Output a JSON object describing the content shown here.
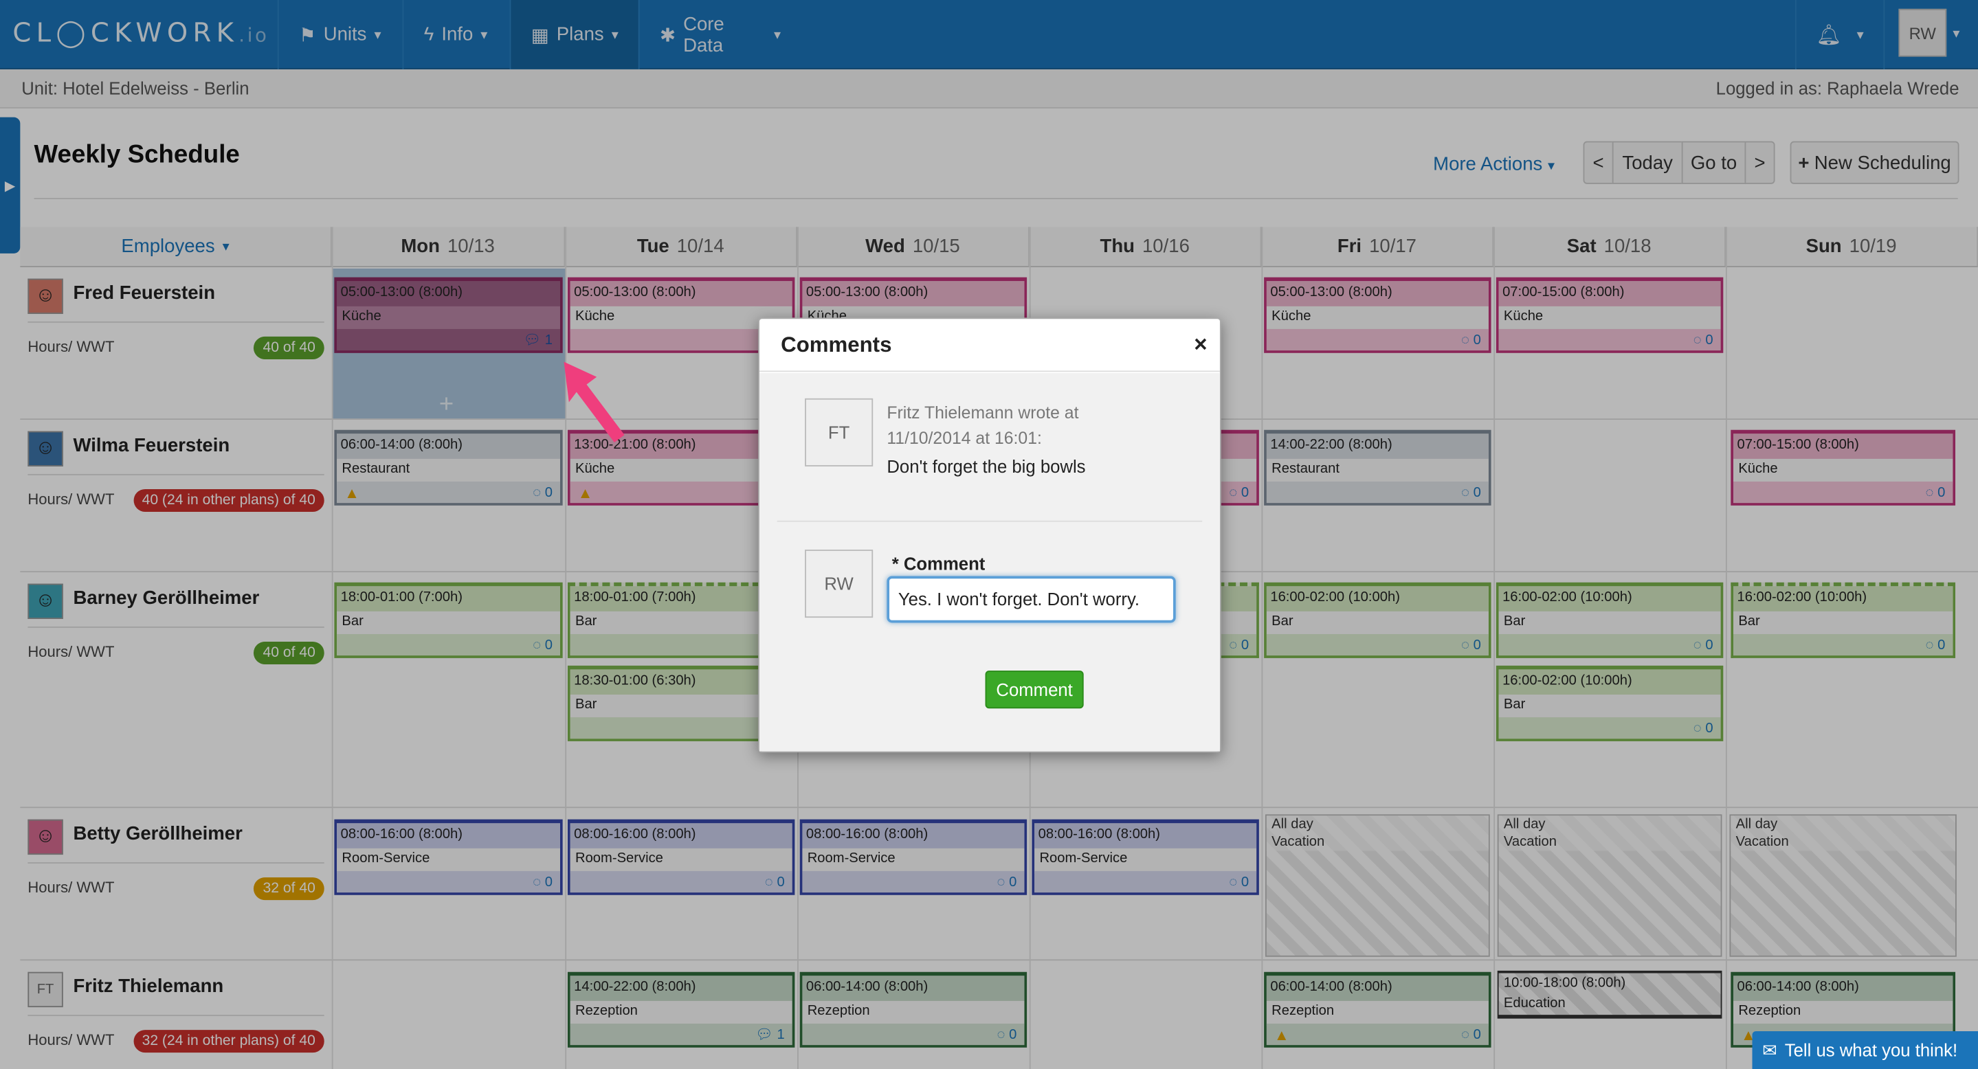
{
  "app": {
    "logo_main": "CL◯CKWORK",
    "logo_suffix": ".io"
  },
  "nav": [
    {
      "icon": "flag-icon",
      "label": "Units"
    },
    {
      "icon": "bolt-icon",
      "label": "Info"
    },
    {
      "icon": "calendar-icon",
      "label": "Plans"
    },
    {
      "icon": "gear-icon",
      "label": "Core Data"
    }
  ],
  "user": {
    "initials": "RW"
  },
  "subbar": {
    "unit": "Unit: Hotel Edelweiss - Berlin",
    "logged_in": "Logged in as: Raphaela Wrede"
  },
  "page": {
    "title": "Weekly Schedule",
    "more_actions": "More Actions",
    "prev": "<",
    "today": "Today",
    "goto": "Go to",
    "next": ">",
    "new_scheduling": "New Scheduling"
  },
  "grid": {
    "employees_label": "Employees",
    "days": [
      {
        "name": "Mon",
        "date": "10/13"
      },
      {
        "name": "Tue",
        "date": "10/14"
      },
      {
        "name": "Wed",
        "date": "10/15"
      },
      {
        "name": "Thu",
        "date": "10/16"
      },
      {
        "name": "Fri",
        "date": "10/17"
      },
      {
        "name": "Sat",
        "date": "10/18"
      },
      {
        "name": "Sun",
        "date": "10/19"
      }
    ],
    "hours_label": "Hours/ WWT",
    "employees": [
      {
        "name": "Fred Feuerstein",
        "badge": "40 of 40",
        "badge_color": "#5aa02c"
      },
      {
        "name": "Wilma Feuerstein",
        "badge": "40 (24 in other plans) of 40",
        "badge_color": "#c9302c"
      },
      {
        "name": "Barney Geröllheimer",
        "badge": "40 of 40",
        "badge_color": "#5aa02c"
      },
      {
        "name": "Betty Geröllheimer",
        "badge": "32 of 40",
        "badge_color": "#e0a000"
      },
      {
        "name": "Fritz Thielemann",
        "badge": "32 (24 in other plans) of 40",
        "badge_color": "#c9302c",
        "initials": "FT"
      }
    ]
  },
  "shifts": {
    "kueche": "Küche",
    "restaurant": "Restaurant",
    "bar": "Bar",
    "room": "Room-Service",
    "rezeption": "Rezeption",
    "education": "Education",
    "s0500": "05:00-13:00 (8:00h)",
    "s0700": "07:00-15:00 (8:00h)",
    "s0600": "06:00-14:00 (8:00h)",
    "s1300": "13:00-21:00 (8:00h)",
    "s1400": "14:00-22:00 (8:00h)",
    "s1800": "18:00-01:00 (7:00h)",
    "s1830": "18:30-01:00 (6:30h)",
    "s1600": "16:00-02:00 (10:00h)",
    "s0800": "08:00-16:00 (8:00h)",
    "s1000": "10:00-18:00 (8:00h)",
    "c0": "0",
    "c1": "1",
    "allday": "All day",
    "vacation": "Vacation",
    "plus": "+"
  },
  "modal": {
    "title": "Comments",
    "close": "×",
    "author_initials": "FT",
    "author_line1": "Fritz Thielemann wrote at",
    "author_line2": "11/10/2014 at 16:01:",
    "comment_text": "Don't forget the big bowls",
    "reply_initials": "RW",
    "field_label": "* Comment",
    "field_value": "Yes. I won't forget. Don't worry.",
    "submit": "Comment"
  },
  "feedback": {
    "label": "Tell us what you think!"
  }
}
